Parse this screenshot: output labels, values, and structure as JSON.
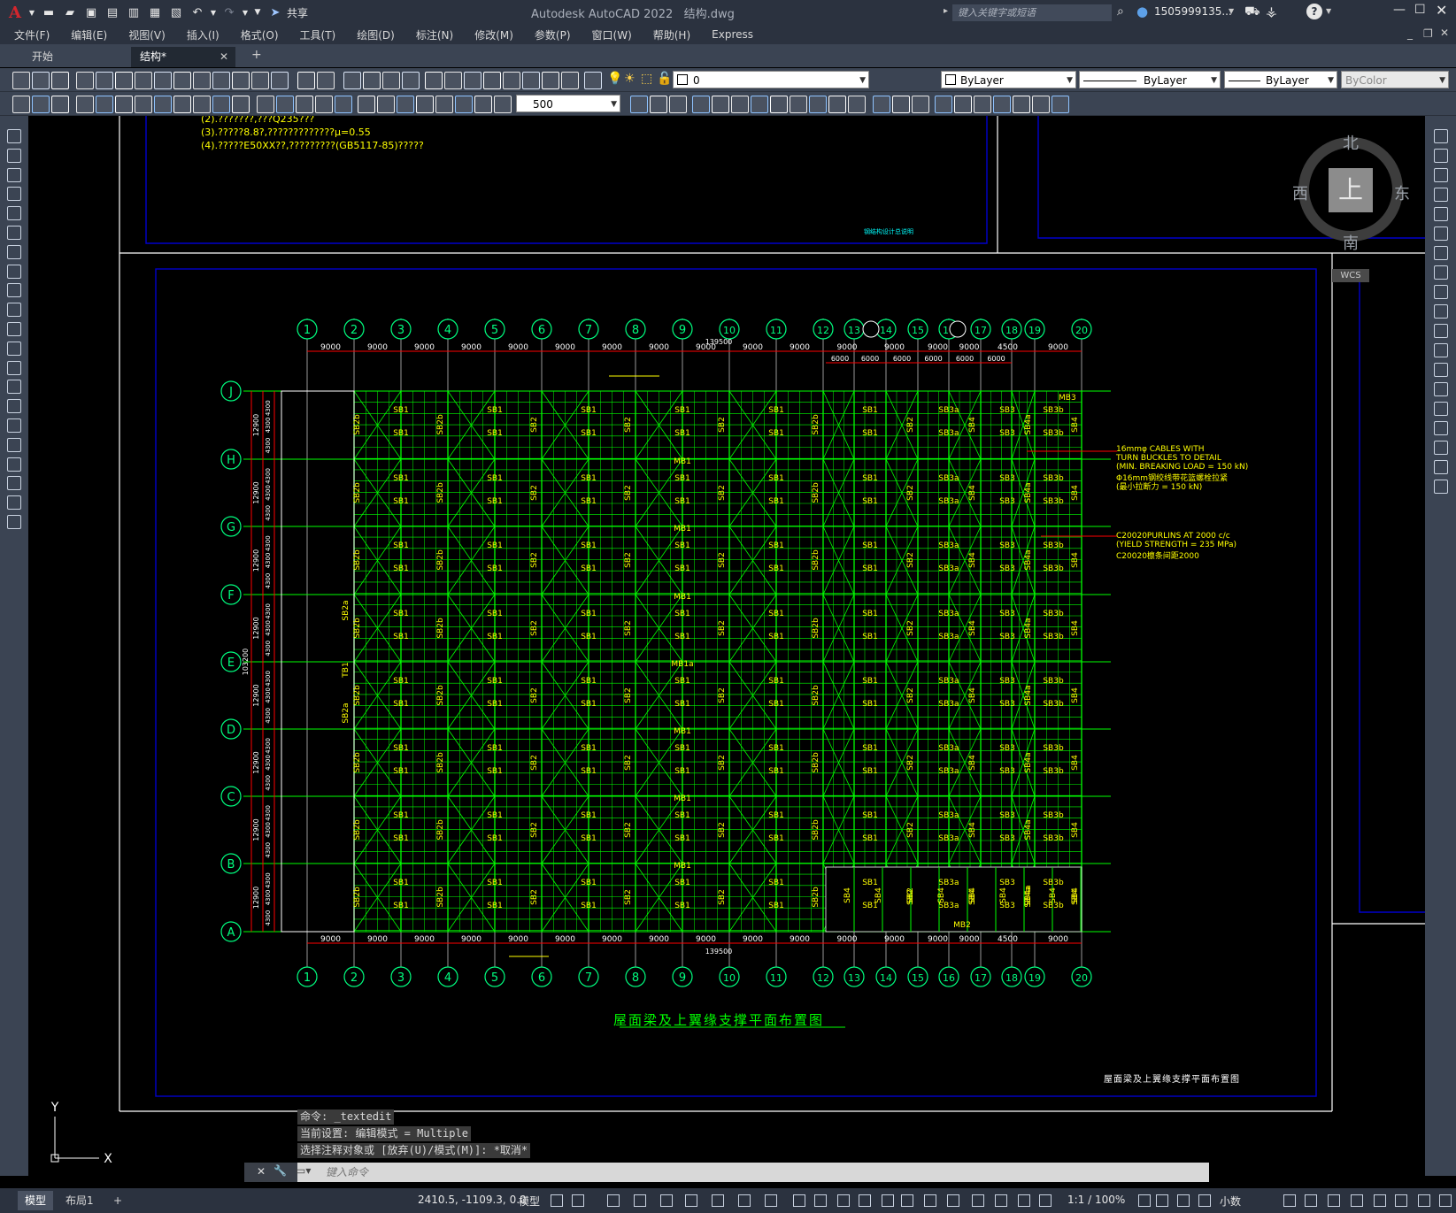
{
  "window": {
    "app_title": "Autodesk AutoCAD 2022",
    "file_name": "结构.dwg",
    "share_label": "共享",
    "search_placeholder": "键入关键字或短语",
    "user": "1505999135...",
    "help": "?"
  },
  "menu": [
    "文件(F)",
    "编辑(E)",
    "视图(V)",
    "插入(I)",
    "格式(O)",
    "工具(T)",
    "绘图(D)",
    "标注(N)",
    "修改(M)",
    "参数(P)",
    "窗口(W)",
    "帮助(H)",
    "Express"
  ],
  "tabs": [
    {
      "label": "开始"
    },
    {
      "label": "结构*"
    }
  ],
  "toolbar": {
    "layer": "0",
    "color": "ByLayer",
    "linetype": "ByLayer",
    "lineweight": "ByLayer",
    "plotstyle": "ByColor",
    "dim_value": "500"
  },
  "viewcube": {
    "north": "北",
    "south": "南",
    "east": "东",
    "west": "西",
    "top": "上",
    "wcs": "WCS"
  },
  "drawing": {
    "notes": [
      "(2).???????,???Q235???",
      "(3).?????8.8?,?????????????μ=0.55",
      "(4).?????E50XX??,?????????(GB5117-85)?????"
    ],
    "top_frame_caption": "钢结构设计总说明",
    "title": "屋面梁及上翼缘支撑平面布置图",
    "title_block": "屋面梁及上翼缘支撑平面布置图",
    "grid_numbers": [
      "1",
      "2",
      "3",
      "4",
      "5",
      "6",
      "7",
      "8",
      "9",
      "10",
      "11",
      "12",
      "13",
      "14",
      "15",
      "16",
      "17",
      "18",
      "19",
      "20"
    ],
    "grid_letters": [
      "J",
      "H",
      "G",
      "F",
      "E",
      "D",
      "C",
      "B",
      "A"
    ],
    "top_dims": [
      "9000",
      "9000",
      "9000",
      "9000",
      "9000",
      "9000",
      "9000",
      "9000",
      "9000",
      "9000",
      "9000",
      "9000",
      "9000",
      "9000",
      "9000",
      "4500",
      "9000"
    ],
    "sub_dims": [
      "6000",
      "6000",
      "6000",
      "6000",
      "6000",
      "6000"
    ],
    "total_dim": "139500",
    "side_total": "103200",
    "side_dims": [
      "12900",
      "4300"
    ],
    "callout_1": [
      "16mmφ CABLES WITH",
      "TURN BUCKLES TO DETAIL",
      "(MIN. BREAKING LOAD = 150 kN)",
      "Φ16mm钢绞线带花篮螺栓拉紧",
      "(最小拉断力 = 150 kN)"
    ],
    "callout_2": [
      "C20020PURLINS AT 2000 c/c",
      "(YIELD STRENGTH = 235 MPa)",
      "C20020檩条间距2000"
    ],
    "labels": {
      "sb1": "SB1",
      "sb2": "SB2",
      "sb2a": "SB2a",
      "sb2b": "SB2b",
      "sb3": "SB3",
      "sb3a": "SB3a",
      "sb3b": "SB3b",
      "sb4": "SB4",
      "sb4a": "SB4a",
      "mb1": "MB1",
      "mb1a": "MB1a",
      "mb2": "MB2",
      "mb3": "MB3",
      "tb1": "TB1"
    }
  },
  "ucs": {
    "y": "Y",
    "x": "X"
  },
  "command": {
    "history": [
      "命令: _textedit",
      "当前设置: 编辑模式 = Multiple",
      "选择注释对象或 [放弃(U)/模式(M)]: *取消*"
    ],
    "placeholder": "键入命令"
  },
  "status": {
    "tabs": [
      "模型",
      "布局1"
    ],
    "coords": "2410.5, -1109.3, 0.0",
    "model_label": "模型",
    "scale": "1:1 / 100%",
    "units": "小数"
  },
  "colors": {
    "grid": "#00ff00",
    "text": "#ffff00",
    "dim_line": "#ff0000",
    "axis": "#00ff80",
    "frame": "#0000cc",
    "white": "#ffffff"
  }
}
